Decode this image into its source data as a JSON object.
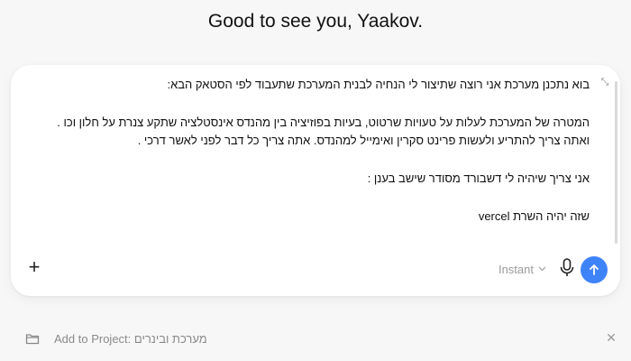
{
  "greeting": "Good to see you, Yaakov.",
  "composer": {
    "lines": [
      "בוא נתכנן מערכת אני רוצה שתיצור לי הנחיה לבנית המערכת שתעבוד לפי הסטאק הבא:",
      "המטרה של המערכת לעלות על טעויות שרטוט, בעיות בפוזיציה בין מהנדס אינסטלציה שתקע צנרת על חלון וכו .",
      "ואתה צריך להתריע ולעשות פרינט סקרין ואימייל למהנדס. אתה צריך כל דבר לפני לאשר דרכי .",
      "אני צריך שיהיה לי דשבורד מסודר שישב בענן :",
      "שזה יהיה השרת vercel"
    ],
    "mode_label": "Instant",
    "plus_label": "+",
    "expand_glyph": "⤡"
  },
  "project": {
    "label": "Add to Project:",
    "name": "מערכת ובינרים",
    "close_glyph": "✕"
  },
  "colors": {
    "send_button": "#3f83f8",
    "background": "#f7f7f8",
    "composer_bg": "#ffffff"
  },
  "icons": [
    "expand-icon",
    "plus-icon",
    "chevron-down-icon",
    "microphone-icon",
    "arrow-up-icon",
    "folder-icon",
    "close-icon"
  ]
}
